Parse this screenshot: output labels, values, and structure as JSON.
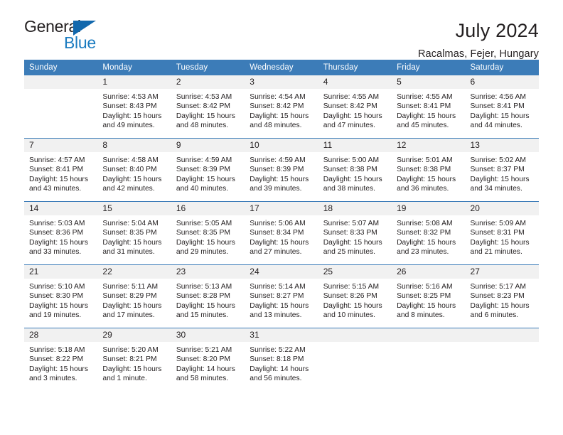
{
  "brand": {
    "name_part1": "General",
    "name_part2": "Blue",
    "triangle_color": "#1268ad",
    "blue_color": "#1c7cc0"
  },
  "header": {
    "title": "July 2024",
    "subtitle": "Racalmas, Fejer, Hungary",
    "header_bg": "#3c7cb8",
    "daynum_bg": "#f1f1f1"
  },
  "weekdays": [
    "Sunday",
    "Monday",
    "Tuesday",
    "Wednesday",
    "Thursday",
    "Friday",
    "Saturday"
  ],
  "weeks": [
    [
      {
        "day": "",
        "sunrise": "",
        "sunset": "",
        "daylight1": "",
        "daylight2": ""
      },
      {
        "day": "1",
        "sunrise": "Sunrise: 4:53 AM",
        "sunset": "Sunset: 8:43 PM",
        "daylight1": "Daylight: 15 hours",
        "daylight2": "and 49 minutes."
      },
      {
        "day": "2",
        "sunrise": "Sunrise: 4:53 AM",
        "sunset": "Sunset: 8:42 PM",
        "daylight1": "Daylight: 15 hours",
        "daylight2": "and 48 minutes."
      },
      {
        "day": "3",
        "sunrise": "Sunrise: 4:54 AM",
        "sunset": "Sunset: 8:42 PM",
        "daylight1": "Daylight: 15 hours",
        "daylight2": "and 48 minutes."
      },
      {
        "day": "4",
        "sunrise": "Sunrise: 4:55 AM",
        "sunset": "Sunset: 8:42 PM",
        "daylight1": "Daylight: 15 hours",
        "daylight2": "and 47 minutes."
      },
      {
        "day": "5",
        "sunrise": "Sunrise: 4:55 AM",
        "sunset": "Sunset: 8:41 PM",
        "daylight1": "Daylight: 15 hours",
        "daylight2": "and 45 minutes."
      },
      {
        "day": "6",
        "sunrise": "Sunrise: 4:56 AM",
        "sunset": "Sunset: 8:41 PM",
        "daylight1": "Daylight: 15 hours",
        "daylight2": "and 44 minutes."
      }
    ],
    [
      {
        "day": "7",
        "sunrise": "Sunrise: 4:57 AM",
        "sunset": "Sunset: 8:41 PM",
        "daylight1": "Daylight: 15 hours",
        "daylight2": "and 43 minutes."
      },
      {
        "day": "8",
        "sunrise": "Sunrise: 4:58 AM",
        "sunset": "Sunset: 8:40 PM",
        "daylight1": "Daylight: 15 hours",
        "daylight2": "and 42 minutes."
      },
      {
        "day": "9",
        "sunrise": "Sunrise: 4:59 AM",
        "sunset": "Sunset: 8:39 PM",
        "daylight1": "Daylight: 15 hours",
        "daylight2": "and 40 minutes."
      },
      {
        "day": "10",
        "sunrise": "Sunrise: 4:59 AM",
        "sunset": "Sunset: 8:39 PM",
        "daylight1": "Daylight: 15 hours",
        "daylight2": "and 39 minutes."
      },
      {
        "day": "11",
        "sunrise": "Sunrise: 5:00 AM",
        "sunset": "Sunset: 8:38 PM",
        "daylight1": "Daylight: 15 hours",
        "daylight2": "and 38 minutes."
      },
      {
        "day": "12",
        "sunrise": "Sunrise: 5:01 AM",
        "sunset": "Sunset: 8:38 PM",
        "daylight1": "Daylight: 15 hours",
        "daylight2": "and 36 minutes."
      },
      {
        "day": "13",
        "sunrise": "Sunrise: 5:02 AM",
        "sunset": "Sunset: 8:37 PM",
        "daylight1": "Daylight: 15 hours",
        "daylight2": "and 34 minutes."
      }
    ],
    [
      {
        "day": "14",
        "sunrise": "Sunrise: 5:03 AM",
        "sunset": "Sunset: 8:36 PM",
        "daylight1": "Daylight: 15 hours",
        "daylight2": "and 33 minutes."
      },
      {
        "day": "15",
        "sunrise": "Sunrise: 5:04 AM",
        "sunset": "Sunset: 8:35 PM",
        "daylight1": "Daylight: 15 hours",
        "daylight2": "and 31 minutes."
      },
      {
        "day": "16",
        "sunrise": "Sunrise: 5:05 AM",
        "sunset": "Sunset: 8:35 PM",
        "daylight1": "Daylight: 15 hours",
        "daylight2": "and 29 minutes."
      },
      {
        "day": "17",
        "sunrise": "Sunrise: 5:06 AM",
        "sunset": "Sunset: 8:34 PM",
        "daylight1": "Daylight: 15 hours",
        "daylight2": "and 27 minutes."
      },
      {
        "day": "18",
        "sunrise": "Sunrise: 5:07 AM",
        "sunset": "Sunset: 8:33 PM",
        "daylight1": "Daylight: 15 hours",
        "daylight2": "and 25 minutes."
      },
      {
        "day": "19",
        "sunrise": "Sunrise: 5:08 AM",
        "sunset": "Sunset: 8:32 PM",
        "daylight1": "Daylight: 15 hours",
        "daylight2": "and 23 minutes."
      },
      {
        "day": "20",
        "sunrise": "Sunrise: 5:09 AM",
        "sunset": "Sunset: 8:31 PM",
        "daylight1": "Daylight: 15 hours",
        "daylight2": "and 21 minutes."
      }
    ],
    [
      {
        "day": "21",
        "sunrise": "Sunrise: 5:10 AM",
        "sunset": "Sunset: 8:30 PM",
        "daylight1": "Daylight: 15 hours",
        "daylight2": "and 19 minutes."
      },
      {
        "day": "22",
        "sunrise": "Sunrise: 5:11 AM",
        "sunset": "Sunset: 8:29 PM",
        "daylight1": "Daylight: 15 hours",
        "daylight2": "and 17 minutes."
      },
      {
        "day": "23",
        "sunrise": "Sunrise: 5:13 AM",
        "sunset": "Sunset: 8:28 PM",
        "daylight1": "Daylight: 15 hours",
        "daylight2": "and 15 minutes."
      },
      {
        "day": "24",
        "sunrise": "Sunrise: 5:14 AM",
        "sunset": "Sunset: 8:27 PM",
        "daylight1": "Daylight: 15 hours",
        "daylight2": "and 13 minutes."
      },
      {
        "day": "25",
        "sunrise": "Sunrise: 5:15 AM",
        "sunset": "Sunset: 8:26 PM",
        "daylight1": "Daylight: 15 hours",
        "daylight2": "and 10 minutes."
      },
      {
        "day": "26",
        "sunrise": "Sunrise: 5:16 AM",
        "sunset": "Sunset: 8:25 PM",
        "daylight1": "Daylight: 15 hours",
        "daylight2": "and 8 minutes."
      },
      {
        "day": "27",
        "sunrise": "Sunrise: 5:17 AM",
        "sunset": "Sunset: 8:23 PM",
        "daylight1": "Daylight: 15 hours",
        "daylight2": "and 6 minutes."
      }
    ],
    [
      {
        "day": "28",
        "sunrise": "Sunrise: 5:18 AM",
        "sunset": "Sunset: 8:22 PM",
        "daylight1": "Daylight: 15 hours",
        "daylight2": "and 3 minutes."
      },
      {
        "day": "29",
        "sunrise": "Sunrise: 5:20 AM",
        "sunset": "Sunset: 8:21 PM",
        "daylight1": "Daylight: 15 hours",
        "daylight2": "and 1 minute."
      },
      {
        "day": "30",
        "sunrise": "Sunrise: 5:21 AM",
        "sunset": "Sunset: 8:20 PM",
        "daylight1": "Daylight: 14 hours",
        "daylight2": "and 58 minutes."
      },
      {
        "day": "31",
        "sunrise": "Sunrise: 5:22 AM",
        "sunset": "Sunset: 8:18 PM",
        "daylight1": "Daylight: 14 hours",
        "daylight2": "and 56 minutes."
      },
      {
        "day": "",
        "sunrise": "",
        "sunset": "",
        "daylight1": "",
        "daylight2": ""
      },
      {
        "day": "",
        "sunrise": "",
        "sunset": "",
        "daylight1": "",
        "daylight2": ""
      },
      {
        "day": "",
        "sunrise": "",
        "sunset": "",
        "daylight1": "",
        "daylight2": ""
      }
    ]
  ]
}
